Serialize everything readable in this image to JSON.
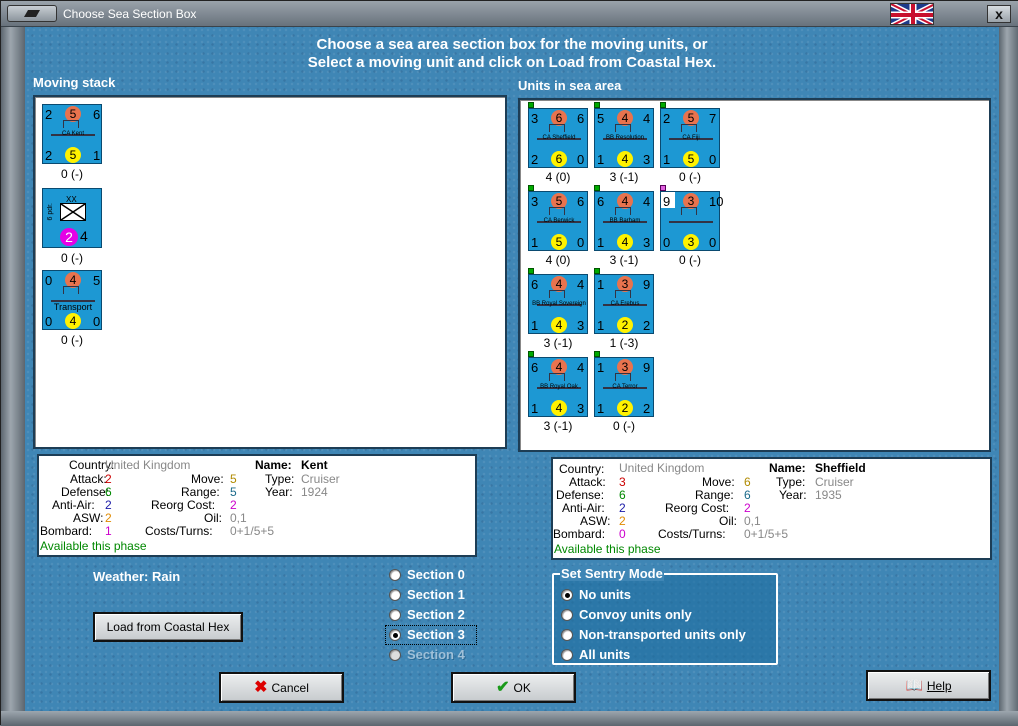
{
  "window": {
    "title": "Choose Sea Section Box",
    "close_label": "x"
  },
  "header": {
    "line1": "Choose a sea area section box for the moving units, or",
    "line2": "Select a moving unit and click on Load from Coastal Hex."
  },
  "moving_stack": {
    "label": "Moving stack",
    "units": [
      {
        "name": "CA Kent",
        "tl": "2",
        "tc": "5",
        "tr": "6",
        "bl": "2",
        "bc": "5",
        "br": "1",
        "caption": "0 (-)"
      },
      {
        "name": "",
        "side": "6 pdr.",
        "top": "XX",
        "bc": "2",
        "br": "4",
        "caption": "0 (-)"
      },
      {
        "name": "Transport",
        "tl": "0",
        "tc": "4",
        "tr": "5",
        "bl": "0",
        "bc": "4",
        "br": "0",
        "caption": "0 (-)"
      }
    ]
  },
  "sea_area": {
    "label": "Units in sea area",
    "units": [
      {
        "name": "CA Sheffield",
        "tl": "3",
        "tc": "6",
        "tr": "6",
        "bl": "2",
        "bc": "6",
        "br": "0",
        "caption": "4 (0)"
      },
      {
        "name": "BB Resolution",
        "tl": "5",
        "tc": "4",
        "tr": "4",
        "bl": "1",
        "bc": "4",
        "br": "3",
        "caption": "3 (-1)"
      },
      {
        "name": "CA Fiji",
        "tl": "2",
        "tc": "5",
        "tr": "7",
        "bl": "1",
        "bc": "5",
        "br": "0",
        "caption": "0 (-)"
      },
      {
        "name": "CA Berwick",
        "tl": "3",
        "tc": "5",
        "tr": "6",
        "bl": "1",
        "bc": "5",
        "br": "0",
        "caption": "4 (0)"
      },
      {
        "name": "BB Barham",
        "tl": "6",
        "tc": "4",
        "tr": "4",
        "bl": "1",
        "bc": "4",
        "br": "3",
        "caption": "3 (-1)"
      },
      {
        "name": "",
        "tl": "9",
        "tc": "3",
        "tr": "10",
        "bl": "0",
        "bc": "3",
        "br": "0",
        "caption": "0 (-)"
      },
      {
        "name": "BB Royal Sovereign",
        "tl": "6",
        "tc": "4",
        "tr": "4",
        "bl": "1",
        "bc": "4",
        "br": "3",
        "caption": "3 (-1)"
      },
      {
        "name": "CA Erebus",
        "tl": "1",
        "tc": "3",
        "tr": "9",
        "bl": "1",
        "bc": "2",
        "br": "2",
        "caption": "1 (-3)"
      },
      {
        "name": "BB Royal Oak",
        "tl": "6",
        "tc": "4",
        "tr": "4",
        "bl": "1",
        "bc": "4",
        "br": "3",
        "caption": "3 (-1)"
      },
      {
        "name": "CA Terror",
        "tl": "1",
        "tc": "3",
        "tr": "9",
        "bl": "1",
        "bc": "2",
        "br": "2",
        "caption": "0 (-)"
      }
    ]
  },
  "info_left": {
    "country_label": "Country:",
    "country": "United Kingdom",
    "attack_label": "Attack:",
    "attack": "2",
    "defense_label": "Defense:",
    "defense": "6",
    "antiair_label": "Anti-Air:",
    "antiair": "2",
    "asw_label": "ASW:",
    "asw": "2",
    "bombard_label": "Bombard:",
    "bombard": "1",
    "move_label": "Move:",
    "move": "5",
    "range_label": "Range:",
    "range": "5",
    "reorg_label": "Reorg Cost:",
    "reorg": "2",
    "oil_label": "Oil:",
    "oil": "0,1",
    "costs_label": "Costs/Turns:",
    "costs": "0+1/5+5",
    "name_label": "Name:",
    "name": "Kent",
    "type_label": "Type:",
    "type": "Cruiser",
    "year_label": "Year:",
    "year": "1924",
    "available": "Available this phase"
  },
  "info_right": {
    "country_label": "Country:",
    "country": "United Kingdom",
    "attack_label": "Attack:",
    "attack": "3",
    "defense_label": "Defense:",
    "defense": "6",
    "antiair_label": "Anti-Air:",
    "antiair": "2",
    "asw_label": "ASW:",
    "asw": "2",
    "bombard_label": "Bombard:",
    "bombard": "0",
    "move_label": "Move:",
    "move": "6",
    "range_label": "Range:",
    "range": "6",
    "reorg_label": "Reorg Cost:",
    "reorg": "2",
    "oil_label": "Oil:",
    "oil": "0,1",
    "costs_label": "Costs/Turns:",
    "costs": "0+1/5+5",
    "name_label": "Name:",
    "name": "Sheffield",
    "type_label": "Type:",
    "type": "Cruiser",
    "year_label": "Year:",
    "year": "1935",
    "available": "Available this phase"
  },
  "weather": "Weather: Rain",
  "load_button": "Load from Coastal Hex",
  "sections": {
    "items": [
      "Section 0",
      "Section 1",
      "Section 2",
      "Section 3",
      "Section 4"
    ],
    "selected": "Section 3"
  },
  "sentry": {
    "title": "Set Sentry Mode",
    "items": [
      "No units",
      "Convoy units only",
      "Non-transported units only",
      "All units"
    ],
    "selected": "No units"
  },
  "buttons": {
    "cancel": "Cancel",
    "ok": "OK",
    "help": "Help"
  },
  "colors": {
    "attack": "#cc0000",
    "defense": "#008800",
    "antiair": "#1a1aa8",
    "asw": "#e08a00",
    "bombard": "#cc00cc",
    "move": "#b08a00",
    "range": "#1a6a8a",
    "reorg": "#cc00cc",
    "grey": "#888888",
    "available": "#008800"
  }
}
